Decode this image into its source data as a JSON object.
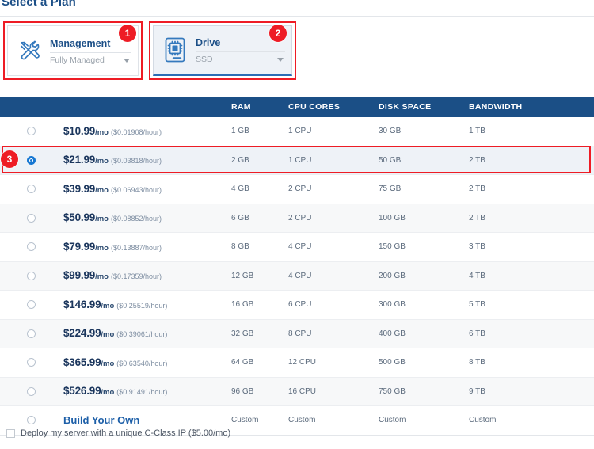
{
  "page": {
    "title": "Select a Plan"
  },
  "selectors": {
    "cards": [
      {
        "id": "management",
        "title": "Management",
        "value": "Fully Managed",
        "icon": "tools-icon",
        "badge": "1",
        "selected": false
      },
      {
        "id": "drive",
        "title": "Drive",
        "value": "SSD",
        "icon": "ssd-drive-icon",
        "badge": "2",
        "selected": true
      }
    ]
  },
  "table": {
    "headers": {
      "radio": "",
      "price": "",
      "ram": "RAM",
      "cpu": "CPU CORES",
      "disk": "DISK SPACE",
      "bandwidth": "BANDWIDTH"
    },
    "rows": [
      {
        "price": "$10.99",
        "per": "/mo",
        "hourly": "($0.01908/hour)",
        "ram": "1 GB",
        "cpu": "1 CPU",
        "disk": "30 GB",
        "bandwidth": "1 TB",
        "selected": false
      },
      {
        "price": "$21.99",
        "per": "/mo",
        "hourly": "($0.03818/hour)",
        "ram": "2 GB",
        "cpu": "1 CPU",
        "disk": "50 GB",
        "bandwidth": "2 TB",
        "selected": true,
        "badge": "3"
      },
      {
        "price": "$39.99",
        "per": "/mo",
        "hourly": "($0.06943/hour)",
        "ram": "4 GB",
        "cpu": "2 CPU",
        "disk": "75 GB",
        "bandwidth": "2 TB",
        "selected": false
      },
      {
        "price": "$50.99",
        "per": "/mo",
        "hourly": "($0.08852/hour)",
        "ram": "6 GB",
        "cpu": "2 CPU",
        "disk": "100 GB",
        "bandwidth": "2 TB",
        "selected": false
      },
      {
        "price": "$79.99",
        "per": "/mo",
        "hourly": "($0.13887/hour)",
        "ram": "8 GB",
        "cpu": "4 CPU",
        "disk": "150 GB",
        "bandwidth": "3 TB",
        "selected": false
      },
      {
        "price": "$99.99",
        "per": "/mo",
        "hourly": "($0.17359/hour)",
        "ram": "12 GB",
        "cpu": "4 CPU",
        "disk": "200 GB",
        "bandwidth": "4 TB",
        "selected": false
      },
      {
        "price": "$146.99",
        "per": "/mo",
        "hourly": "($0.25519/hour)",
        "ram": "16 GB",
        "cpu": "6 CPU",
        "disk": "300 GB",
        "bandwidth": "5 TB",
        "selected": false
      },
      {
        "price": "$224.99",
        "per": "/mo",
        "hourly": "($0.39061/hour)",
        "ram": "32 GB",
        "cpu": "8 CPU",
        "disk": "400 GB",
        "bandwidth": "6 TB",
        "selected": false
      },
      {
        "price": "$365.99",
        "per": "/mo",
        "hourly": "($0.63540/hour)",
        "ram": "64 GB",
        "cpu": "12 CPU",
        "disk": "500 GB",
        "bandwidth": "8 TB",
        "selected": false
      },
      {
        "price": "$526.99",
        "per": "/mo",
        "hourly": "($0.91491/hour)",
        "ram": "96 GB",
        "cpu": "16 CPU",
        "disk": "750 GB",
        "bandwidth": "9 TB",
        "selected": false
      },
      {
        "price": "Build Your Own",
        "per": "",
        "hourly": "",
        "ram": "Custom",
        "cpu": "Custom",
        "disk": "Custom",
        "bandwidth": "Custom",
        "selected": false,
        "custom": true
      }
    ]
  },
  "footer": {
    "cclass_label": "Deploy my server with a unique C-Class IP ($5.00/mo)",
    "cclass_checked": false
  },
  "colors": {
    "header_blue": "#1b4f86",
    "title_blue": "#1c4f87",
    "annotation_red": "#ee1c25",
    "accent_link": "#1d5fa8",
    "row_alt": "#f7f8f9",
    "row_selected": "#eef2f7"
  }
}
